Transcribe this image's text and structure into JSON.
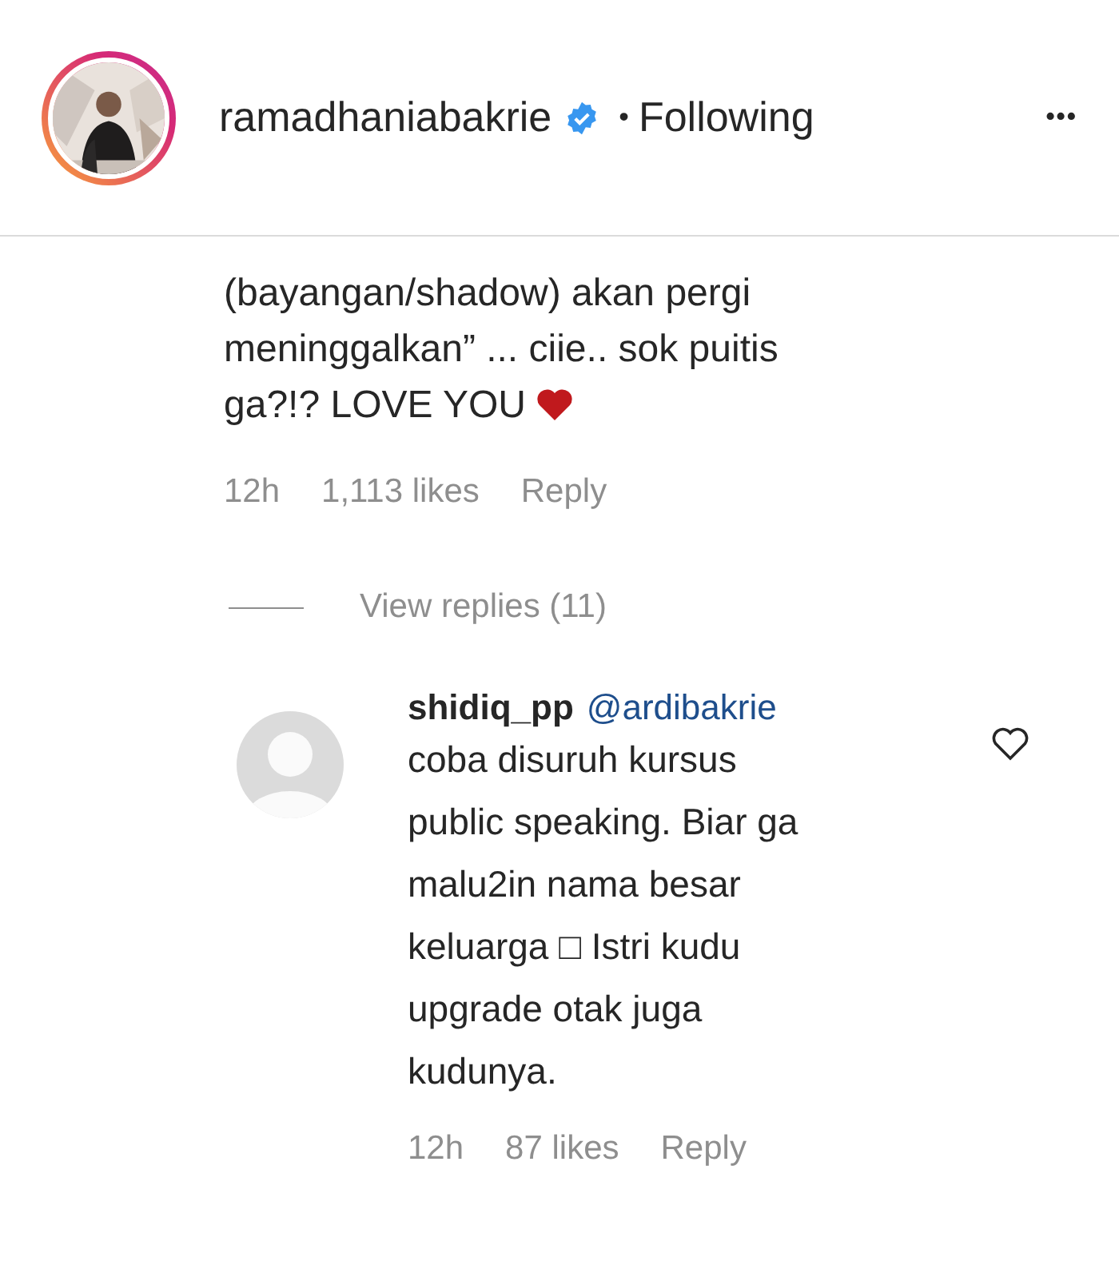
{
  "header": {
    "username": "ramadhaniabakrie",
    "verified": true,
    "separator": "•",
    "follow_status": "Following",
    "more": "•••"
  },
  "comment": {
    "text": "(bayangan/shadow) akan pergi\nmeninggalkan” ... ciie.. sok puitis\nga?!? LOVE YOU",
    "heart": true,
    "time": "12h",
    "likes": "1,113 likes",
    "reply": "Reply"
  },
  "view_replies": "View replies (11)",
  "replies": [
    {
      "username": "shidiq_pp",
      "mention": "@ardibakrie",
      "text": "coba disuruh kursus\npublic speaking. Biar ga\nmalu2in nama besar\nkeluarga □ Istri kudu\nupgrade otak juga\nkudunya.",
      "liked": false,
      "time": "12h",
      "likes": "87 likes",
      "reply": "Reply"
    }
  ]
}
